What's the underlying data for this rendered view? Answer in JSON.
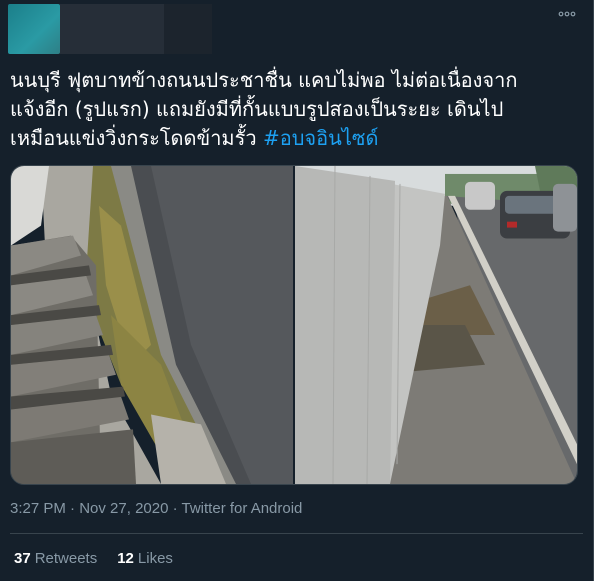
{
  "header": {
    "more_icon": "more-dots-icon"
  },
  "tweet": {
    "text_lines": [
      "นนบุรี ฟุตบาทข้างถนนประชาชื่น แคบไม่พอ ไม่ต่อเนื่องจาก",
      "แจ้งอีก (รูปแรก) แถมยังมีที่กั้นแบบรูปสองเป็นระยะ เดินไป",
      "เหมือนแข่งวิ่งกระโดดข้ามรั้ว "
    ],
    "hashtag": "#อบจอินไซด์"
  },
  "meta": {
    "time": "3:27 PM",
    "separator": " · ",
    "date": "Nov 27, 2020",
    "source": "Twitter for Android"
  },
  "stats": {
    "retweets_count": "37",
    "retweets_label": "Retweets",
    "likes_count": "12",
    "likes_label": "Likes"
  },
  "colors": {
    "background": "#15202b",
    "text": "#ffffff",
    "secondary": "#8899a6",
    "link": "#1da1f2",
    "border": "#38444d"
  }
}
